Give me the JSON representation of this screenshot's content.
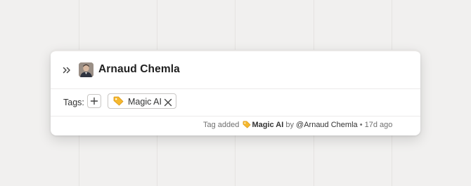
{
  "record": {
    "name": "Arnaud Chemla"
  },
  "tags": {
    "label": "Tags:",
    "items": [
      {
        "label": "Magic AI",
        "color": "#f5b82e"
      }
    ]
  },
  "activity": {
    "prefix": "Tag added",
    "tag": "Magic AI",
    "by": "by",
    "author": "@Arnaud Chemla",
    "separator": "•",
    "time": "17d ago"
  }
}
